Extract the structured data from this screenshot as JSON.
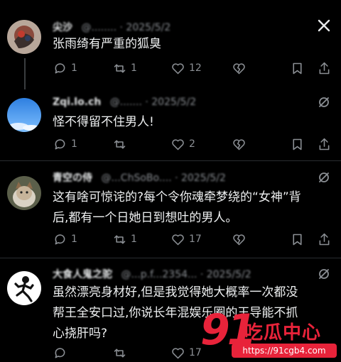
{
  "posts": [
    {
      "author": "尖沙",
      "meta": "@........ · 2025/5/2",
      "text": "张雨绮有严重的狐臭",
      "replies": "1",
      "reposts": "1",
      "likes": "12",
      "avatar": "tattoo-photo"
    },
    {
      "author": "Zqi.lo.ch",
      "meta": "@....... · 2025/5/2",
      "text": "怪不得留不住男人!",
      "replies": "1",
      "reposts": "",
      "likes": "2",
      "avatar": "blue-sky"
    },
    {
      "author": "青空の侍",
      "meta": "@...ChSoBo.... · 2025/5/2",
      "text_line1": "这有啥可惊诧的?每个令你魂牵梦绕的“女神”背",
      "text_line2": "后,都有一个日她日到想吐的男人。",
      "replies": "1",
      "reposts": "1",
      "likes": "17",
      "avatar": "cat-photo"
    },
    {
      "author": "大食人鬼之驼",
      "meta": "@...p.f...2354... · 2025/5/2",
      "text_line1": "虽然漂亮身材好,但是我觉得她大概率一次都没",
      "text_line2": "帮王全安口过,你说长年混娱乐圈的王导能不抓",
      "text_line3": "心挠肝吗?",
      "replies": "",
      "reposts": "",
      "likes": "17",
      "avatar": "running-figure"
    }
  ],
  "watermark": {
    "number": "91",
    "brand": "吃瓜中心",
    "url": "https://91cgb4.com"
  },
  "colors": {
    "background": "#000000",
    "text": "#e7e9ea",
    "muted": "#8b8f94",
    "watermark": "#e8233a"
  }
}
